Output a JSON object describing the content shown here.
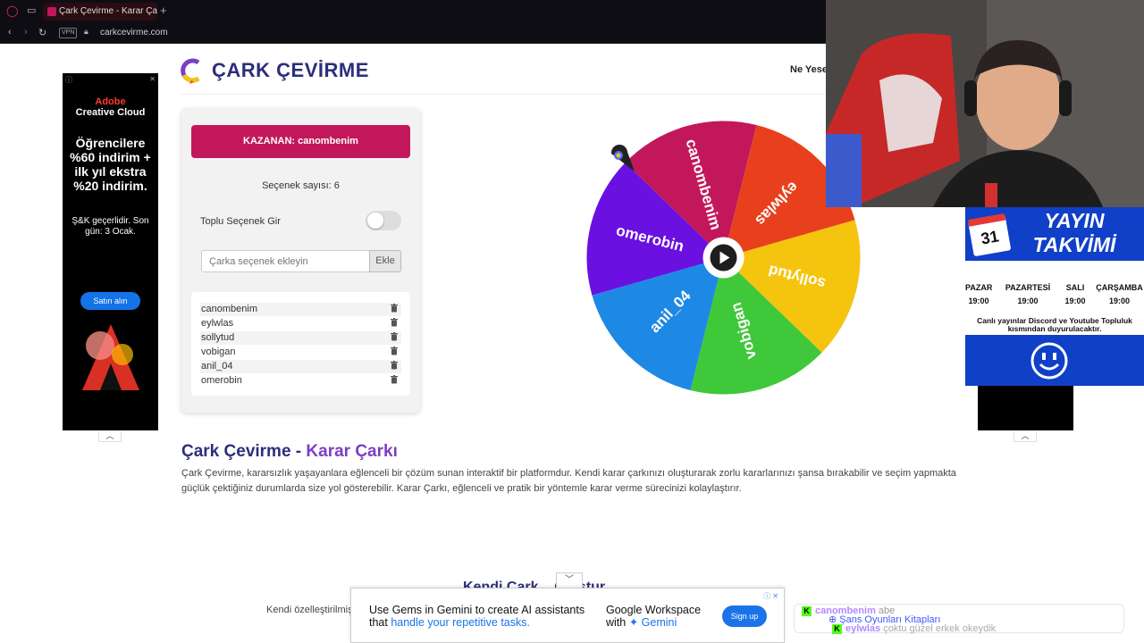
{
  "browser": {
    "tab_title": "Çark Çevirme - Karar Çarkı",
    "new_tab": "+",
    "vpn": "VPN",
    "url": "carkcevirme.com"
  },
  "header": {
    "logo_text": "ÇARK ÇEVİRME",
    "nav_link": "Ne Yeser"
  },
  "controls": {
    "winner": "KAZANAN: canombenim",
    "option_count": "Seçenek sayısı: 6",
    "bulk_label": "Toplu Seçenek Gir",
    "bulk_enabled": false,
    "input_placeholder": "Çarka seçenek ekleyin",
    "add_button": "Ekle",
    "options": [
      "canombenim",
      "eylwlas",
      "sollytud",
      "vobigan",
      "anil_04",
      "omerobin"
    ]
  },
  "wheel": {
    "segments": [
      {
        "label": "canombenim",
        "color": "#c2185b"
      },
      {
        "label": "eylwlas",
        "color": "#e8401c"
      },
      {
        "label": "sollytud",
        "color": "#f5c40f"
      },
      {
        "label": "vobigan",
        "color": "#3fc83a"
      },
      {
        "label": "anil_04",
        "color": "#1e88e5"
      },
      {
        "label": "omerobin",
        "color": "#6a10e0"
      }
    ]
  },
  "content": {
    "title_part1": "Çark Çevirme - ",
    "title_part2": "Karar Çarkı",
    "paragraph": "Çark Çevirme, kararsızlık yaşayanlara eğlenceli bir çözüm sunan interaktif bir platformdur. Kendi karar çarkınızı oluşturarak zorlu kararlarınızı şansa bırakabilir ve seçim yapmakta güçlük çektiğiniz durumlarda size yol gösterebilir. Karar Çarkı, eğlenceli ve pratik bir yöntemle karar verme sürecinizi kolaylaştırır.",
    "subheading_partial": "Kendi Çark... Oluştur",
    "paragraph2_partial": "Kendi özelleştirilmiş"
  },
  "ad_left": {
    "brand_line1": "Adobe",
    "brand_line2": "Creative Cloud",
    "headline": "Öğrencilere %60 indirim + ilk yıl ekstra %20 indirim.",
    "sub": "Ş&K geçerlidir. Son gün: 3 Ocak.",
    "cta": "Satın alın"
  },
  "ad_bottom": {
    "text1_a": "Use Gems in Gemini to create AI assistants",
    "text1_b": "that ",
    "text1_link": "handle your repetitive tasks.",
    "text2_a": "Google Workspace",
    "text2_b": "with ",
    "text2_link": "Gemini",
    "cta": "Sign up"
  },
  "schedule": {
    "title_line1": "YAYIN",
    "title_line2": "TAKVİMİ",
    "cal_day": "31",
    "days": [
      {
        "day": "PAZAR",
        "time": "19:00"
      },
      {
        "day": "PAZARTESİ",
        "time": "19:00"
      },
      {
        "day": "SALI",
        "time": "19:00"
      },
      {
        "day": "ÇARŞAMBA",
        "time": "19:00"
      }
    ],
    "note": "Canlı yayınlar Discord ve Youtube Topluluk kısmından duyurulacaktır."
  },
  "chat": {
    "line1_user": "canombenim",
    "line1_msg": "abe",
    "line2_msg": "Şans Oyunları Kitapları",
    "line3_user": "eylwlas",
    "line3_msg": "çoktu güzel erkek okeydik"
  },
  "colors": {
    "brand": "#2b2f7a",
    "accent": "#c2185b",
    "schedule_blue": "#1040c8"
  }
}
